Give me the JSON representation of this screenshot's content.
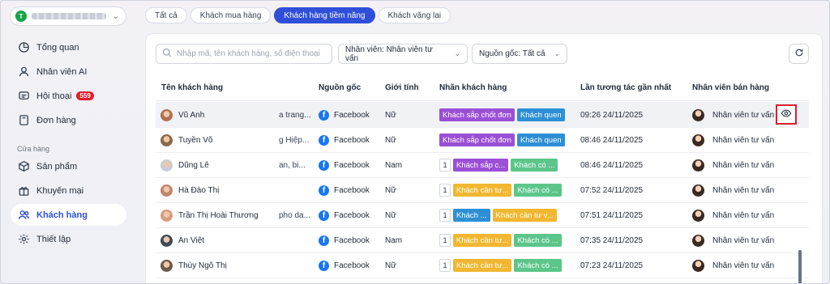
{
  "sidebar": {
    "workspace_initial": "T",
    "workspace_name": "workspace",
    "items": [
      {
        "label": "Tổng quan",
        "icon": "chart-pie-icon"
      },
      {
        "label": "Nhân viên AI",
        "icon": "ai-agent-icon"
      },
      {
        "label": "Hội thoại",
        "icon": "chat-icon",
        "badge": "559"
      },
      {
        "label": "Đơn hàng",
        "icon": "order-icon"
      },
      {
        "label": "Sản phẩm",
        "icon": "box-icon"
      },
      {
        "label": "Khuyến mại",
        "icon": "gift-icon"
      },
      {
        "label": "Khách hàng",
        "icon": "users-icon"
      },
      {
        "label": "Thiết lập",
        "icon": "gear-icon"
      }
    ],
    "section_label": "Cửa hàng",
    "active_item": "Khách hàng"
  },
  "tabs": [
    {
      "label": "Tất cả"
    },
    {
      "label": "Khách mua hàng"
    },
    {
      "label": "Khách hàng tiềm năng",
      "active": true
    },
    {
      "label": "Khách vãng lai"
    }
  ],
  "toolbar": {
    "search_placeholder": "Nhập mã, tên khách hàng, số điện thoại",
    "staff_filter": "Nhân viên: Nhân viên tư vấn",
    "source_filter": "Nguồn gốc: Tất cả"
  },
  "table": {
    "columns": [
      "Tên khách hàng",
      "Nguồn gốc",
      "Giới tính",
      "Nhãn khách hàng",
      "Lần tương tác gần nhất",
      "Nhân viên bán hàng"
    ],
    "rows": [
      {
        "name": "Vũ Anh",
        "extra": "a trang...",
        "source": "Facebook",
        "gender": "Nữ",
        "count": "",
        "tags": [
          {
            "text": "Khách sắp chốt đơn",
            "color": "#9b4fd6"
          },
          {
            "text": "Khách quen",
            "color": "#2d8fd5"
          }
        ],
        "time": "09:26 24/11/2025",
        "staff": "Nhân viên tư vấn",
        "ava": "#b07050"
      },
      {
        "name": "Tuyền Võ",
        "extra": "g Hiệp...",
        "source": "Facebook",
        "gender": "Nữ",
        "count": "",
        "tags": [
          {
            "text": "Khách sắp chốt đơn",
            "color": "#9b4fd6"
          },
          {
            "text": "Khách quen",
            "color": "#2d8fd5"
          }
        ],
        "time": "08:46 24/11/2025",
        "staff": "Nhân viên tư vấn",
        "ava": "#8a6a4a"
      },
      {
        "name": "Dũng Lê",
        "extra": "an, bi...",
        "source": "Facebook",
        "gender": "Nam",
        "count": "1",
        "tags": [
          {
            "text": "Khách sắp c...",
            "color": "#9b4fd6"
          },
          {
            "text": "Khách có ...",
            "color": "#5cc58a"
          }
        ],
        "time": "08:46 24/11/2025",
        "staff": "Nhân viên tư vấn",
        "ava": "#c9ccd6"
      },
      {
        "name": "Hà Đào Thị",
        "extra": "",
        "source": "Facebook",
        "gender": "Nữ",
        "count": "1",
        "tags": [
          {
            "text": "Khách cần tư...",
            "color": "#f2b730"
          },
          {
            "text": "Khách có ...",
            "color": "#5cc58a"
          }
        ],
        "time": "07:52 24/11/2025",
        "staff": "Nhân viên tư vấn",
        "ava": "#c0856a"
      },
      {
        "name": "Trần Thị Hoài Thương",
        "extra": "pho da...",
        "source": "Facebook",
        "gender": "Nữ",
        "count": "1",
        "tags": [
          {
            "text": "Khách ...",
            "color": "#2d8fd5"
          },
          {
            "text": "Khách cần tư v...",
            "color": "#f2b730"
          }
        ],
        "time": "07:51 24/11/2025",
        "staff": "Nhân viên tư vấn",
        "ava": "#d89a80"
      },
      {
        "name": "An Việt",
        "extra": "",
        "source": "Facebook",
        "gender": "Nam",
        "count": "1",
        "tags": [
          {
            "text": "Khách cần tư...",
            "color": "#f2b730"
          },
          {
            "text": "Khách có ...",
            "color": "#5cc58a"
          }
        ],
        "time": "07:35 24/11/2025",
        "staff": "Nhân viên tư vấn",
        "ava": "#3c4a5a"
      },
      {
        "name": "Thùy Ngô Thị",
        "extra": "",
        "source": "Facebook",
        "gender": "Nữ",
        "count": "1",
        "tags": [
          {
            "text": "Khách cần tư...",
            "color": "#f2b730"
          },
          {
            "text": "Khách có ...",
            "color": "#5cc58a"
          }
        ],
        "time": "07:23 24/11/2025",
        "staff": "Nhân viên tư vấn",
        "ava": "#6e5a4a"
      }
    ]
  },
  "colors": {
    "accent": "#2f4fd8",
    "highlight_box": "#e11d2e",
    "facebook": "#1877f2"
  }
}
